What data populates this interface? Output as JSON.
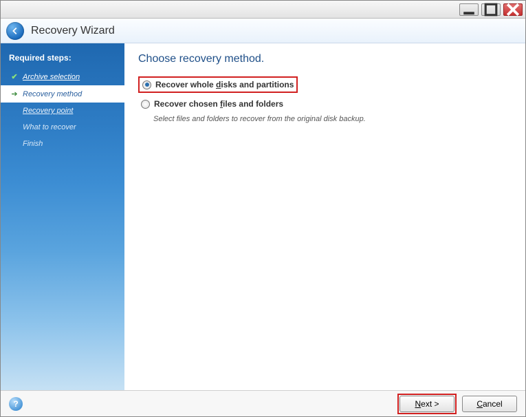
{
  "window": {
    "title": "Recovery Wizard"
  },
  "sidebar": {
    "heading": "Required steps:",
    "steps": [
      {
        "label": "Archive selection",
        "state": "done"
      },
      {
        "label": "Recovery method",
        "state": "active"
      },
      {
        "label": "Recovery point",
        "state": "pending"
      },
      {
        "label": "What to recover",
        "state": "future"
      },
      {
        "label": "Finish",
        "state": "future"
      }
    ]
  },
  "main": {
    "heading": "Choose recovery method.",
    "options": [
      {
        "label_pre": "Recover whole ",
        "label_ul": "d",
        "label_post": "isks and partitions",
        "selected": true,
        "highlighted": true
      },
      {
        "label_pre": "Recover chosen ",
        "label_ul": "f",
        "label_post": "iles and folders",
        "selected": false,
        "highlighted": false,
        "description": "Select files and folders to recover from the original disk backup."
      }
    ]
  },
  "footer": {
    "next_ul": "N",
    "next_post": "ext >",
    "cancel_ul": "C",
    "cancel_post": "ancel",
    "next_highlighted": true
  }
}
